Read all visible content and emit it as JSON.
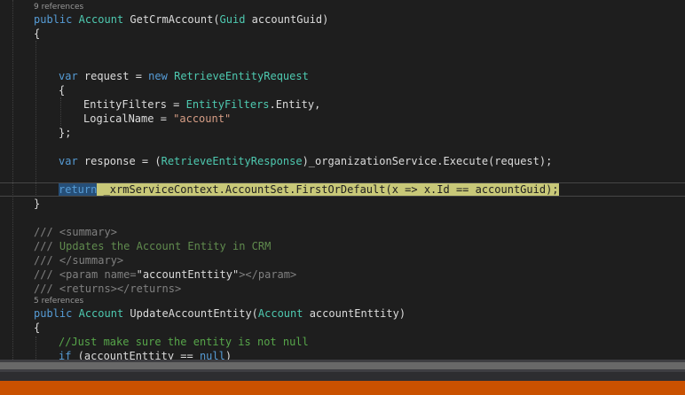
{
  "editor": {
    "codelens_1": "9 references",
    "codelens_2": "5 references",
    "lines": {
      "sig1_kw": "public",
      "sig1_type": "Account",
      "sig1_name": " GetCrmAccount(",
      "sig1_ptype": "Guid",
      "sig1_pname": " accountGuid)",
      "brace_open_1": "{",
      "var1_kw": "var",
      "var1_mid": " request = ",
      "var1_new": "new",
      "var1_type": "RetrieveEntityRequest",
      "brace_open_2": "{",
      "ef_prop": "EntityFilters = ",
      "ef_type": "EntityFilters",
      "ef_rest": ".Entity,",
      "ln_prop": "LogicalName = ",
      "ln_str": "\"account\"",
      "brace_close_2": "};",
      "var2_kw": "var",
      "var2_mid": " response = (",
      "var2_type": "RetrieveEntityResponse",
      "var2_rest": ")_organizationService.Execute(request);",
      "ret_kw": "return",
      "ret_rest": " _xrmServiceContext.AccountSet.FirstOrDefault(x => x.Id == accountGuid);",
      "brace_close_1": "}",
      "doc1_slash": "/// ",
      "doc1_tag": "<summary>",
      "doc2_slash": "/// ",
      "doc2_text": "Updates the Account Entity in CRM",
      "doc3_slash": "/// ",
      "doc3_tag": "</summary>",
      "doc4_slash": "/// ",
      "doc4_tag_open": "<param ",
      "doc4_attr": "name=",
      "doc4_val": "\"accountEnttity\"",
      "doc4_tag_close": "></param>",
      "doc5_slash": "/// ",
      "doc5_tag": "<returns></returns>",
      "sig2_kw": "public",
      "sig2_type": "Account",
      "sig2_name": " UpdateAccountEntity(",
      "sig2_ptype": "Account",
      "sig2_pname": " accountEnttity)",
      "brace_open_3": "{",
      "comment_1": "//Just make sure the entity is not null",
      "if_kw": "if",
      "if_mid": " (accountEnttity == ",
      "if_null": "null",
      "if_end": ")"
    }
  },
  "colors": {
    "background": "#1e1e1e",
    "keyword": "#569cd6",
    "type": "#4ec9b0",
    "string": "#d69d85",
    "comment": "#57a64a",
    "text": "#dcdcdc",
    "statement_highlight": "#c8c878",
    "selection": "#264f78",
    "status_bar": "#ca5100"
  }
}
